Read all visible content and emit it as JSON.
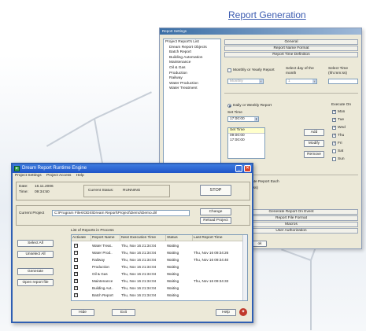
{
  "headline": "Report Generation",
  "report_settings": {
    "title": "Report Settings",
    "report_list": [
      {
        "label": "Project Report's List",
        "child": false
      },
      {
        "label": "Dream Report Objects",
        "child": true
      },
      {
        "label": "Batch Report",
        "child": true
      },
      {
        "label": "Building Automation",
        "child": true
      },
      {
        "label": "Maintenance",
        "child": true
      },
      {
        "label": "Oil & Gas",
        "child": true
      },
      {
        "label": "Production",
        "child": true
      },
      {
        "label": "Railway",
        "child": true
      },
      {
        "label": "Water Production",
        "child": true
      },
      {
        "label": "Water Treatment",
        "child": true
      }
    ],
    "buttons": {
      "general": "General",
      "name_format": "Report Name Format",
      "time_definition": "Report Time Definition",
      "gen_on_event": "Generate Report On Event",
      "file_format": "Report File Format",
      "macros": "Macros",
      "user_auth": "User Authorization"
    },
    "monthly": {
      "label": "Monthly or Yearly Report",
      "select_day_label": "Select day of the month",
      "select_time_label": "Select Time (hh:mm:ss)",
      "monthly_value": "Monthly",
      "day_value": "1"
    },
    "daily": {
      "label": "Daily or Weekly Report",
      "set_time_label": "Set Time",
      "time_value": "17:00:00",
      "list_header": "Set Time",
      "times": [
        "09:00:00",
        "17:00:00"
      ],
      "add": "Add",
      "modify": "Modify",
      "remove": "Remove",
      "execute_on": "Execute On",
      "days": [
        {
          "label": "Mon",
          "checked": true
        },
        {
          "label": "Tue",
          "checked": true
        },
        {
          "label": "Wed",
          "checked": true
        },
        {
          "label": "Thu",
          "checked": true
        },
        {
          "label": "Fri",
          "checked": true
        },
        {
          "label": "Sat",
          "checked": false
        },
        {
          "label": "Sun",
          "checked": false
        }
      ]
    },
    "each": {
      "label": "ate Report Each",
      "unit": "(ss)"
    },
    "ok_fragment": "ok"
  },
  "runtime": {
    "title": "Dream Report Runtime Engine",
    "menu": [
      "Project Settings",
      "Project Access",
      "Help"
    ],
    "date_label": "Date:",
    "date_value": "16.11.2006",
    "time_label": "Time:",
    "time_value": "09:34:50",
    "status_label": "Current Status:",
    "status_value": "RUNNING",
    "stop": "STOP",
    "project_label": "Current Project",
    "project_path": "C:\\Program Files\\ODS\\Dream Report\\Project\\Demo\\Demo.drl",
    "change": "Change",
    "reload": "Reload Project",
    "list_title": "List of Reports in Process",
    "select_all": "Select All",
    "unselect_all": "Unselect All",
    "generate": "Generate",
    "open_report_file": "Open report file",
    "columns": [
      "Activate",
      "Report Name",
      "Next Execution Time",
      "Status",
      "Last Report Time"
    ],
    "rows": [
      [
        "Water Treat..",
        "Thu, Nov 16 21:34:04",
        "Waiting",
        ""
      ],
      [
        "Water Prod..",
        "Thu, Nov 16 21:34:04",
        "Waiting",
        "Thu, Nov 16 09:34:26"
      ],
      [
        "Railway",
        "Thu, Nov 16 21:34:04",
        "Waiting",
        "Thu, Nov 16 09:34:40"
      ],
      [
        "Production",
        "Thu, Nov 16 21:34:04",
        "Waiting",
        ""
      ],
      [
        "Oil & Gas",
        "Thu, Nov 16 21:34:04",
        "Waiting",
        ""
      ],
      [
        "Maintenance",
        "Thu, Nov 16 21:34:04",
        "Waiting",
        "Thu, Nov 16 09:34:33"
      ],
      [
        "Building Aut..",
        "Thu, Nov 16 21:34:04",
        "Waiting",
        ""
      ],
      [
        "Batch Report",
        "Thu, Nov 16 21:34:04",
        "Waiting",
        ""
      ]
    ],
    "hide": "Hide",
    "exit": "Exit",
    "help": "Help"
  }
}
